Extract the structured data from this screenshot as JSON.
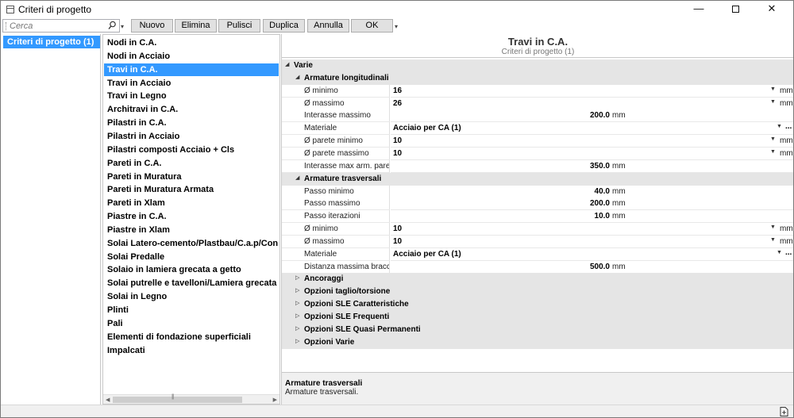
{
  "window": {
    "title": "Criteri di progetto",
    "minimize_glyph": "—",
    "close_glyph": "✕"
  },
  "toolbar": {
    "search_placeholder": "Cerca",
    "buttons": [
      "Nuovo",
      "Elimina",
      "Pulisci",
      "Duplica",
      "Annulla",
      "OK"
    ],
    "overflow_glyph": "▾"
  },
  "left_panel": {
    "items": [
      "Criteri di progetto (1)"
    ]
  },
  "mid_panel": {
    "items": [
      "Nodi in C.A.",
      "Nodi in Acciaio",
      "Travi in C.A.",
      "Travi in Acciaio",
      "Travi in Legno",
      "Architravi in C.A.",
      "Pilastri in C.A.",
      "Pilastri in Acciaio",
      "Pilastri composti Acciaio + Cls",
      "Pareti in C.A.",
      "Pareti in Muratura",
      "Pareti in Muratura Armata",
      "Pareti in Xlam",
      "Piastre in C.A.",
      "Piastre in Xlam",
      "Solai Latero-cemento/Plastbau/C.a.p/Con traliccio",
      "Solai Predalle",
      "Solaio in lamiera grecata a getto",
      "Solai putrelle e tavelloni/Lamiera grecata non collaborante",
      "Solai in Legno",
      "Plinti",
      "Pali",
      "Elementi di fondazione superficiali",
      "Impalcati"
    ],
    "selected": "Travi in C.A."
  },
  "right_panel": {
    "title": "Travi in C.A.",
    "subtitle": "Criteri di progetto (1)",
    "rows": [
      {
        "kind": "cat",
        "level": 0,
        "expanded": true,
        "label": "Varie"
      },
      {
        "kind": "cat",
        "level": 1,
        "expanded": true,
        "label": "Armature longitudinali"
      },
      {
        "kind": "prop",
        "label": "Ø minimo",
        "value": "16",
        "align": "left",
        "control": "dropdown",
        "unit": "mm"
      },
      {
        "kind": "prop",
        "label": "Ø massimo",
        "value": "26",
        "align": "left",
        "control": "dropdown",
        "unit": "mm"
      },
      {
        "kind": "prop",
        "label": "Interasse massimo",
        "value": "200.0",
        "align": "right",
        "control": "none",
        "unit": "mm"
      },
      {
        "kind": "prop",
        "label": "Materiale",
        "value": "Acciaio per CA (1)",
        "align": "left",
        "control": "dropdown-ellipsis",
        "unit": "..."
      },
      {
        "kind": "prop",
        "label": "Ø parete minimo",
        "value": "10",
        "align": "left",
        "control": "dropdown",
        "unit": "mm"
      },
      {
        "kind": "prop",
        "label": "Ø parete massimo",
        "value": "10",
        "align": "left",
        "control": "dropdown",
        "unit": "mm"
      },
      {
        "kind": "prop",
        "label": "Interasse max arm. parete",
        "value": "350.0",
        "align": "right",
        "control": "none",
        "unit": "mm"
      },
      {
        "kind": "cat",
        "level": 1,
        "expanded": true,
        "label": "Armature trasversali"
      },
      {
        "kind": "prop",
        "label": "Passo minimo",
        "value": "40.0",
        "align": "right",
        "control": "none",
        "unit": "mm"
      },
      {
        "kind": "prop",
        "label": "Passo massimo",
        "value": "200.0",
        "align": "right",
        "control": "none",
        "unit": "mm"
      },
      {
        "kind": "prop",
        "label": "Passo iterazioni",
        "value": "10.0",
        "align": "right",
        "control": "none",
        "unit": "mm"
      },
      {
        "kind": "prop",
        "label": "Ø minimo",
        "value": "10",
        "align": "left",
        "control": "dropdown",
        "unit": "mm"
      },
      {
        "kind": "prop",
        "label": "Ø massimo",
        "value": "10",
        "align": "left",
        "control": "dropdown",
        "unit": "mm"
      },
      {
        "kind": "prop",
        "label": "Materiale",
        "value": "Acciaio per CA (1)",
        "align": "left",
        "control": "dropdown-ellipsis",
        "unit": "..."
      },
      {
        "kind": "prop",
        "label": "Distanza massima bracci",
        "value": "500.0",
        "align": "right",
        "control": "none",
        "unit": "mm"
      },
      {
        "kind": "cat",
        "level": 1,
        "expanded": false,
        "label": "Ancoraggi"
      },
      {
        "kind": "cat",
        "level": 1,
        "expanded": false,
        "label": "Opzioni taglio/torsione"
      },
      {
        "kind": "cat",
        "level": 1,
        "expanded": false,
        "label": "Opzioni SLE Caratteristiche"
      },
      {
        "kind": "cat",
        "level": 1,
        "expanded": false,
        "label": "Opzioni SLE Frequenti"
      },
      {
        "kind": "cat",
        "level": 1,
        "expanded": false,
        "label": "Opzioni SLE Quasi Permanenti"
      },
      {
        "kind": "cat",
        "level": 1,
        "expanded": false,
        "label": "Opzioni Varie"
      }
    ],
    "description": {
      "title": "Armature trasversali",
      "text": "Armature trasversali."
    }
  },
  "colors": {
    "selection": "#3399ff",
    "category_bg": "#e5e5e5",
    "button_bg": "#e1e1e1"
  }
}
